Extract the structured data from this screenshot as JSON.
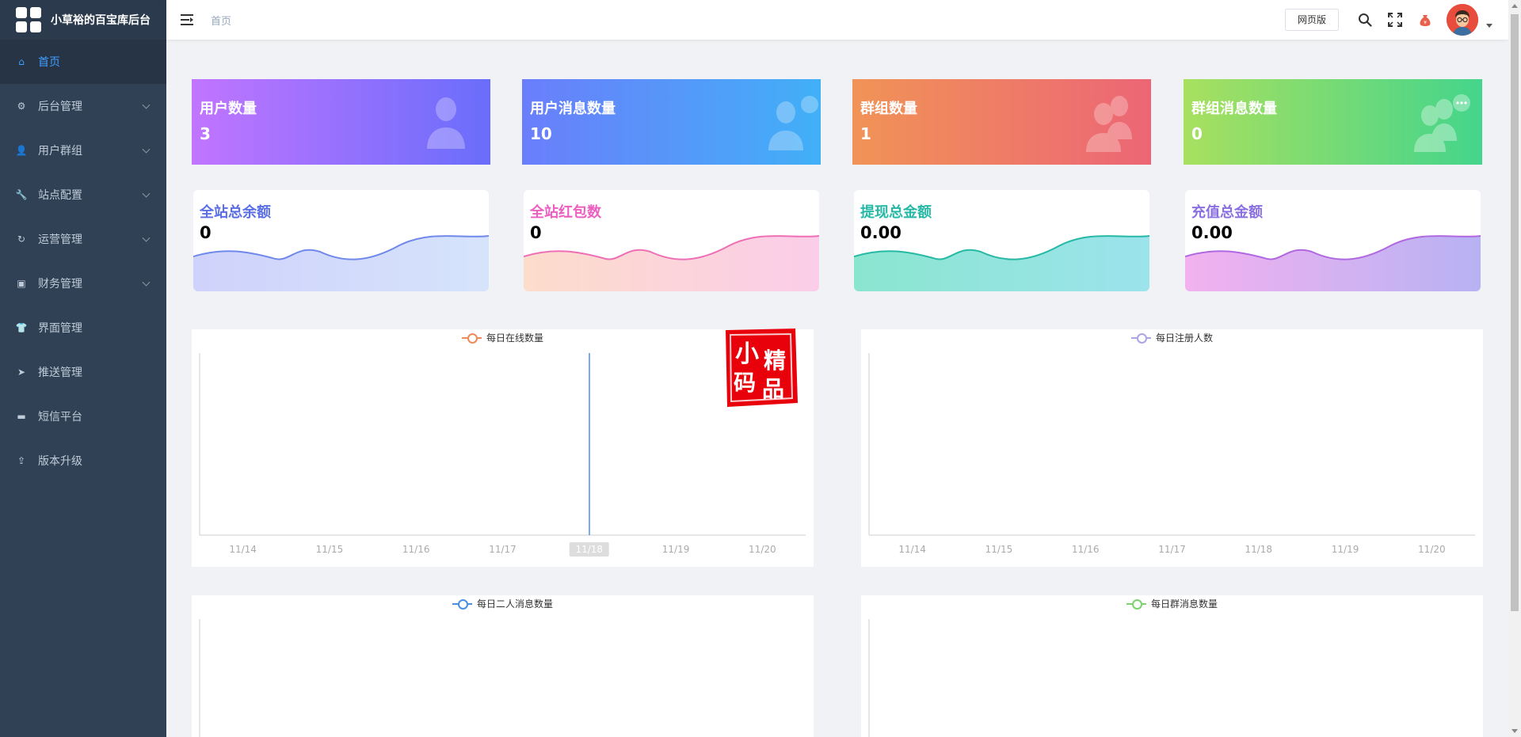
{
  "app": {
    "title": "小草裕的百宝库后台"
  },
  "sidebar": {
    "items": [
      {
        "label": "首页",
        "icon": "home-icon",
        "active": true,
        "has_children": false
      },
      {
        "label": "后台管理",
        "icon": "gear-icon",
        "active": false,
        "has_children": true
      },
      {
        "label": "用户群组",
        "icon": "user-icon",
        "active": false,
        "has_children": true
      },
      {
        "label": "站点配置",
        "icon": "wrench-icon",
        "active": false,
        "has_children": true
      },
      {
        "label": "运营管理",
        "icon": "refresh-icon",
        "active": false,
        "has_children": true
      },
      {
        "label": "财务管理",
        "icon": "wallet-icon",
        "active": false,
        "has_children": true
      },
      {
        "label": "界面管理",
        "icon": "shirt-icon",
        "active": false,
        "has_children": false
      },
      {
        "label": "推送管理",
        "icon": "send-icon",
        "active": false,
        "has_children": false
      },
      {
        "label": "短信平台",
        "icon": "message-icon",
        "active": false,
        "has_children": false
      },
      {
        "label": "版本升级",
        "icon": "upload-icon",
        "active": false,
        "has_children": false
      }
    ]
  },
  "header": {
    "breadcrumb": "首页",
    "web_button": "网页版",
    "icons": [
      "search-icon",
      "fullscreen-icon",
      "money-bag-icon"
    ]
  },
  "stats": [
    {
      "label": "用户数量",
      "value": "3"
    },
    {
      "label": "用户消息数量",
      "value": "10"
    },
    {
      "label": "群组数量",
      "value": "1"
    },
    {
      "label": "群组消息数量",
      "value": "0"
    }
  ],
  "waves": [
    {
      "label": "全站总余额",
      "value": "0",
      "color": "#5a6ee5"
    },
    {
      "label": "全站红包数",
      "value": "0",
      "color": "#ec5ec0"
    },
    {
      "label": "提现总金额",
      "value": "0.00",
      "color": "#25b9a5"
    },
    {
      "label": "充值总金额",
      "value": "0.00",
      "color": "#8a6fe0"
    }
  ],
  "seal": {
    "text": "小码精品"
  },
  "chart_data": [
    {
      "type": "line",
      "series": [
        {
          "name": "每日在线数量",
          "color": "#ee8a59",
          "values": []
        }
      ],
      "categories": [
        "11/14",
        "11/15",
        "11/16",
        "11/17",
        "11/18",
        "11/19",
        "11/20"
      ],
      "highlighted_category": "11/18"
    },
    {
      "type": "line",
      "series": [
        {
          "name": "每日注册人数",
          "color": "#a9a5e6",
          "values": []
        }
      ],
      "categories": [
        "11/14",
        "11/15",
        "11/16",
        "11/17",
        "11/18",
        "11/19",
        "11/20"
      ]
    },
    {
      "type": "line",
      "series": [
        {
          "name": "每日二人消息数量",
          "color": "#4a90e2",
          "values": []
        }
      ],
      "categories": []
    },
    {
      "type": "line",
      "series": [
        {
          "name": "每日群消息数量",
          "color": "#7bd36b",
          "values": []
        }
      ],
      "categories": []
    }
  ]
}
